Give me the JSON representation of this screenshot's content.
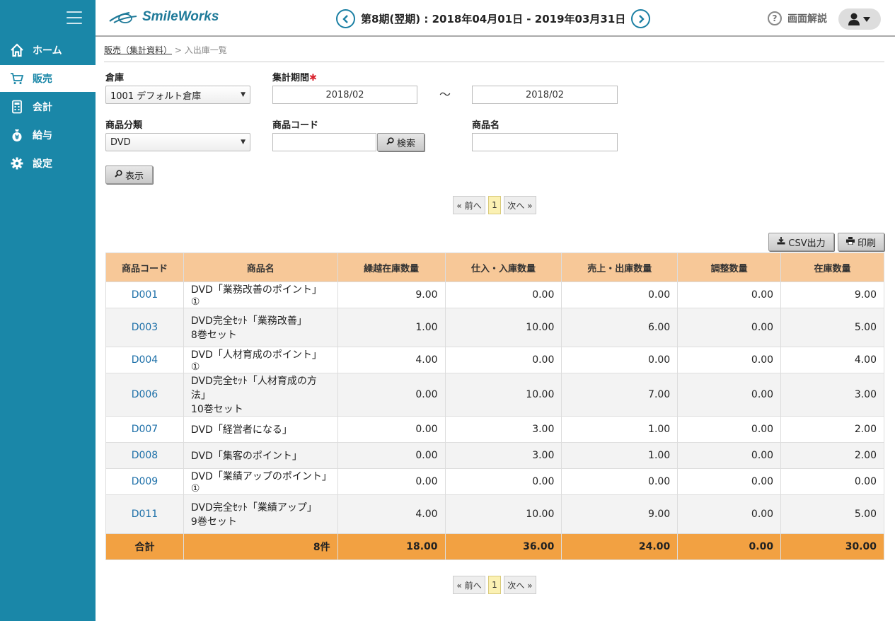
{
  "app": {
    "logo": "SmileWorks"
  },
  "header": {
    "period": "第8期(翌期) : 2018年04月01日 - 2019年03月31日",
    "help": "画面解説"
  },
  "sidebar": {
    "items": [
      {
        "label": "ホーム",
        "icon": "home-icon"
      },
      {
        "label": "販売",
        "icon": "cart-icon"
      },
      {
        "label": "会計",
        "icon": "calculator-icon"
      },
      {
        "label": "給与",
        "icon": "money-bag-icon"
      },
      {
        "label": "設定",
        "icon": "gear-icon"
      }
    ],
    "active": "販売"
  },
  "breadcrumb": {
    "parent": "販売（集計資料）",
    "sep": ">",
    "current": "入出庫一覧"
  },
  "form": {
    "warehouse_label": "倉庫",
    "warehouse_value": "1001 デフォルト倉庫",
    "period_label": "集計期間",
    "period_required": "✱",
    "period_from": "2018/02",
    "period_tilde": "〜",
    "period_to": "2018/02",
    "category_label": "商品分類",
    "category_value": "DVD",
    "code_label": "商品コード",
    "code_value": "",
    "search_btn": "検索",
    "name_label": "商品名",
    "name_value": "",
    "show_btn": "表示"
  },
  "pager": {
    "prev": "« 前へ",
    "page": "1",
    "next": "次へ »"
  },
  "actions": {
    "csv": "CSV出力",
    "print": "印刷"
  },
  "table": {
    "headers": [
      "商品コード",
      "商品名",
      "繰越在庫数量",
      "仕入・入庫数量",
      "売上・出庫数量",
      "調整数量",
      "在庫数量"
    ],
    "rows": [
      {
        "code": "D001",
        "name1": "DVD「業務改善のポイント」①",
        "name2": "",
        "carry": "9.00",
        "in": "0.00",
        "out": "0.00",
        "adj": "0.00",
        "stock": "9.00"
      },
      {
        "code": "D003",
        "name1": "DVD完全ｾｯﾄ「業務改善」",
        "name2": "8巻セット",
        "carry": "1.00",
        "in": "10.00",
        "out": "6.00",
        "adj": "0.00",
        "stock": "5.00"
      },
      {
        "code": "D004",
        "name1": "DVD「人材育成のポイント」①",
        "name2": "",
        "carry": "4.00",
        "in": "0.00",
        "out": "0.00",
        "adj": "0.00",
        "stock": "4.00"
      },
      {
        "code": "D006",
        "name1": "DVD完全ｾｯﾄ「人材育成の方法」",
        "name2": "10巻セット",
        "carry": "0.00",
        "in": "10.00",
        "out": "7.00",
        "adj": "0.00",
        "stock": "3.00"
      },
      {
        "code": "D007",
        "name1": "DVD「経営者になる」",
        "name2": "",
        "carry": "0.00",
        "in": "3.00",
        "out": "1.00",
        "adj": "0.00",
        "stock": "2.00"
      },
      {
        "code": "D008",
        "name1": "DVD「集客のポイント」",
        "name2": "",
        "carry": "0.00",
        "in": "3.00",
        "out": "1.00",
        "adj": "0.00",
        "stock": "2.00"
      },
      {
        "code": "D009",
        "name1": "DVD「業績アップのポイント」①",
        "name2": "",
        "carry": "0.00",
        "in": "0.00",
        "out": "0.00",
        "adj": "0.00",
        "stock": "0.00"
      },
      {
        "code": "D011",
        "name1": "DVD完全ｾｯﾄ「業績アップ」",
        "name2": "9巻セット",
        "carry": "4.00",
        "in": "10.00",
        "out": "9.00",
        "adj": "0.00",
        "stock": "5.00"
      }
    ],
    "total": {
      "label": "合計",
      "count": "8件",
      "carry": "18.00",
      "in": "36.00",
      "out": "24.00",
      "adj": "0.00",
      "stock": "30.00"
    }
  },
  "colors": {
    "sidebar": "#1a87a8",
    "header_row": "#f7c898",
    "total_row": "#f2a142",
    "link": "#1c6fa8"
  }
}
